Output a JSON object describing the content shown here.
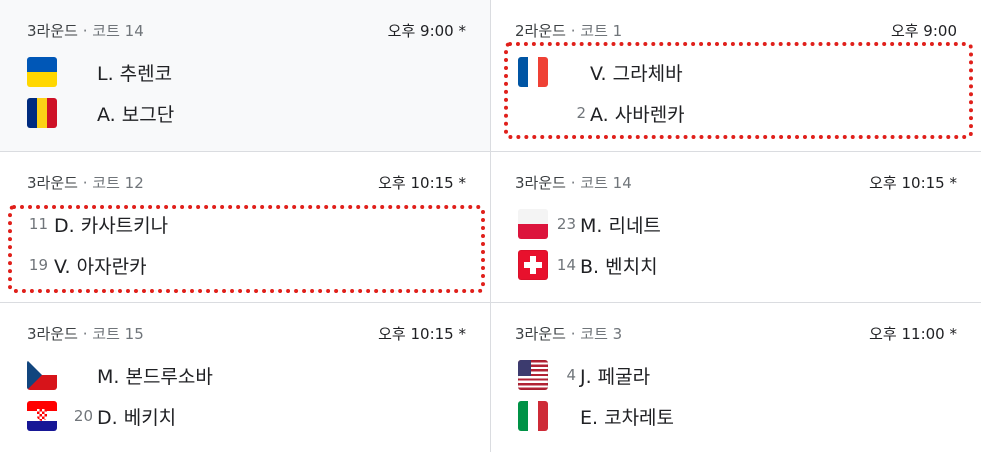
{
  "matches": [
    {
      "round": "3라운드",
      "sep": "·",
      "court": "코트 14",
      "time": "오후 9:00",
      "time_mark": "*",
      "players": [
        {
          "seed": "",
          "name": "L. 추렌코",
          "flag": "ukraine-flag-icon"
        },
        {
          "seed": "",
          "name": "A. 보그단",
          "flag": "romania-flag-icon"
        }
      ]
    },
    {
      "round": "2라운드",
      "sep": "·",
      "court": "코트 1",
      "time": "오후 9:00",
      "time_mark": "",
      "players": [
        {
          "seed": "",
          "name": "V. 그라체바",
          "flag": "france-flag-icon"
        },
        {
          "seed": "2",
          "name": "A. 사바렌카",
          "flag": ""
        }
      ]
    },
    {
      "round": "3라운드",
      "sep": "·",
      "court": "코트 12",
      "time": "오후 10:15",
      "time_mark": "*",
      "players": [
        {
          "seed": "11",
          "name": "D. 카사트키나",
          "flag": ""
        },
        {
          "seed": "19",
          "name": "V. 아자란카",
          "flag": ""
        }
      ]
    },
    {
      "round": "3라운드",
      "sep": "·",
      "court": "코트 14",
      "time": "오후 10:15",
      "time_mark": "*",
      "players": [
        {
          "seed": "23",
          "name": "M. 리네트",
          "flag": "poland-flag-icon"
        },
        {
          "seed": "14",
          "name": "B. 벤치치",
          "flag": "switzerland-flag-icon"
        }
      ]
    },
    {
      "round": "3라운드",
      "sep": "·",
      "court": "코트 15",
      "time": "오후 10:15",
      "time_mark": "*",
      "players": [
        {
          "seed": "",
          "name": "M. 본드루소바",
          "flag": "czech-flag-icon"
        },
        {
          "seed": "20",
          "name": "D. 베키치",
          "flag": "croatia-flag-icon"
        }
      ]
    },
    {
      "round": "3라운드",
      "sep": "·",
      "court": "코트 3",
      "time": "오후 11:00",
      "time_mark": "*",
      "players": [
        {
          "seed": "4",
          "name": "J. 페굴라",
          "flag": "usa-flag-icon"
        },
        {
          "seed": "",
          "name": "E. 코차레토",
          "flag": "italy-flag-icon"
        }
      ]
    }
  ],
  "colors": {
    "highlight": "#e0201b",
    "divider": "#dadce0",
    "selected_bg": "#f8f9fa"
  }
}
